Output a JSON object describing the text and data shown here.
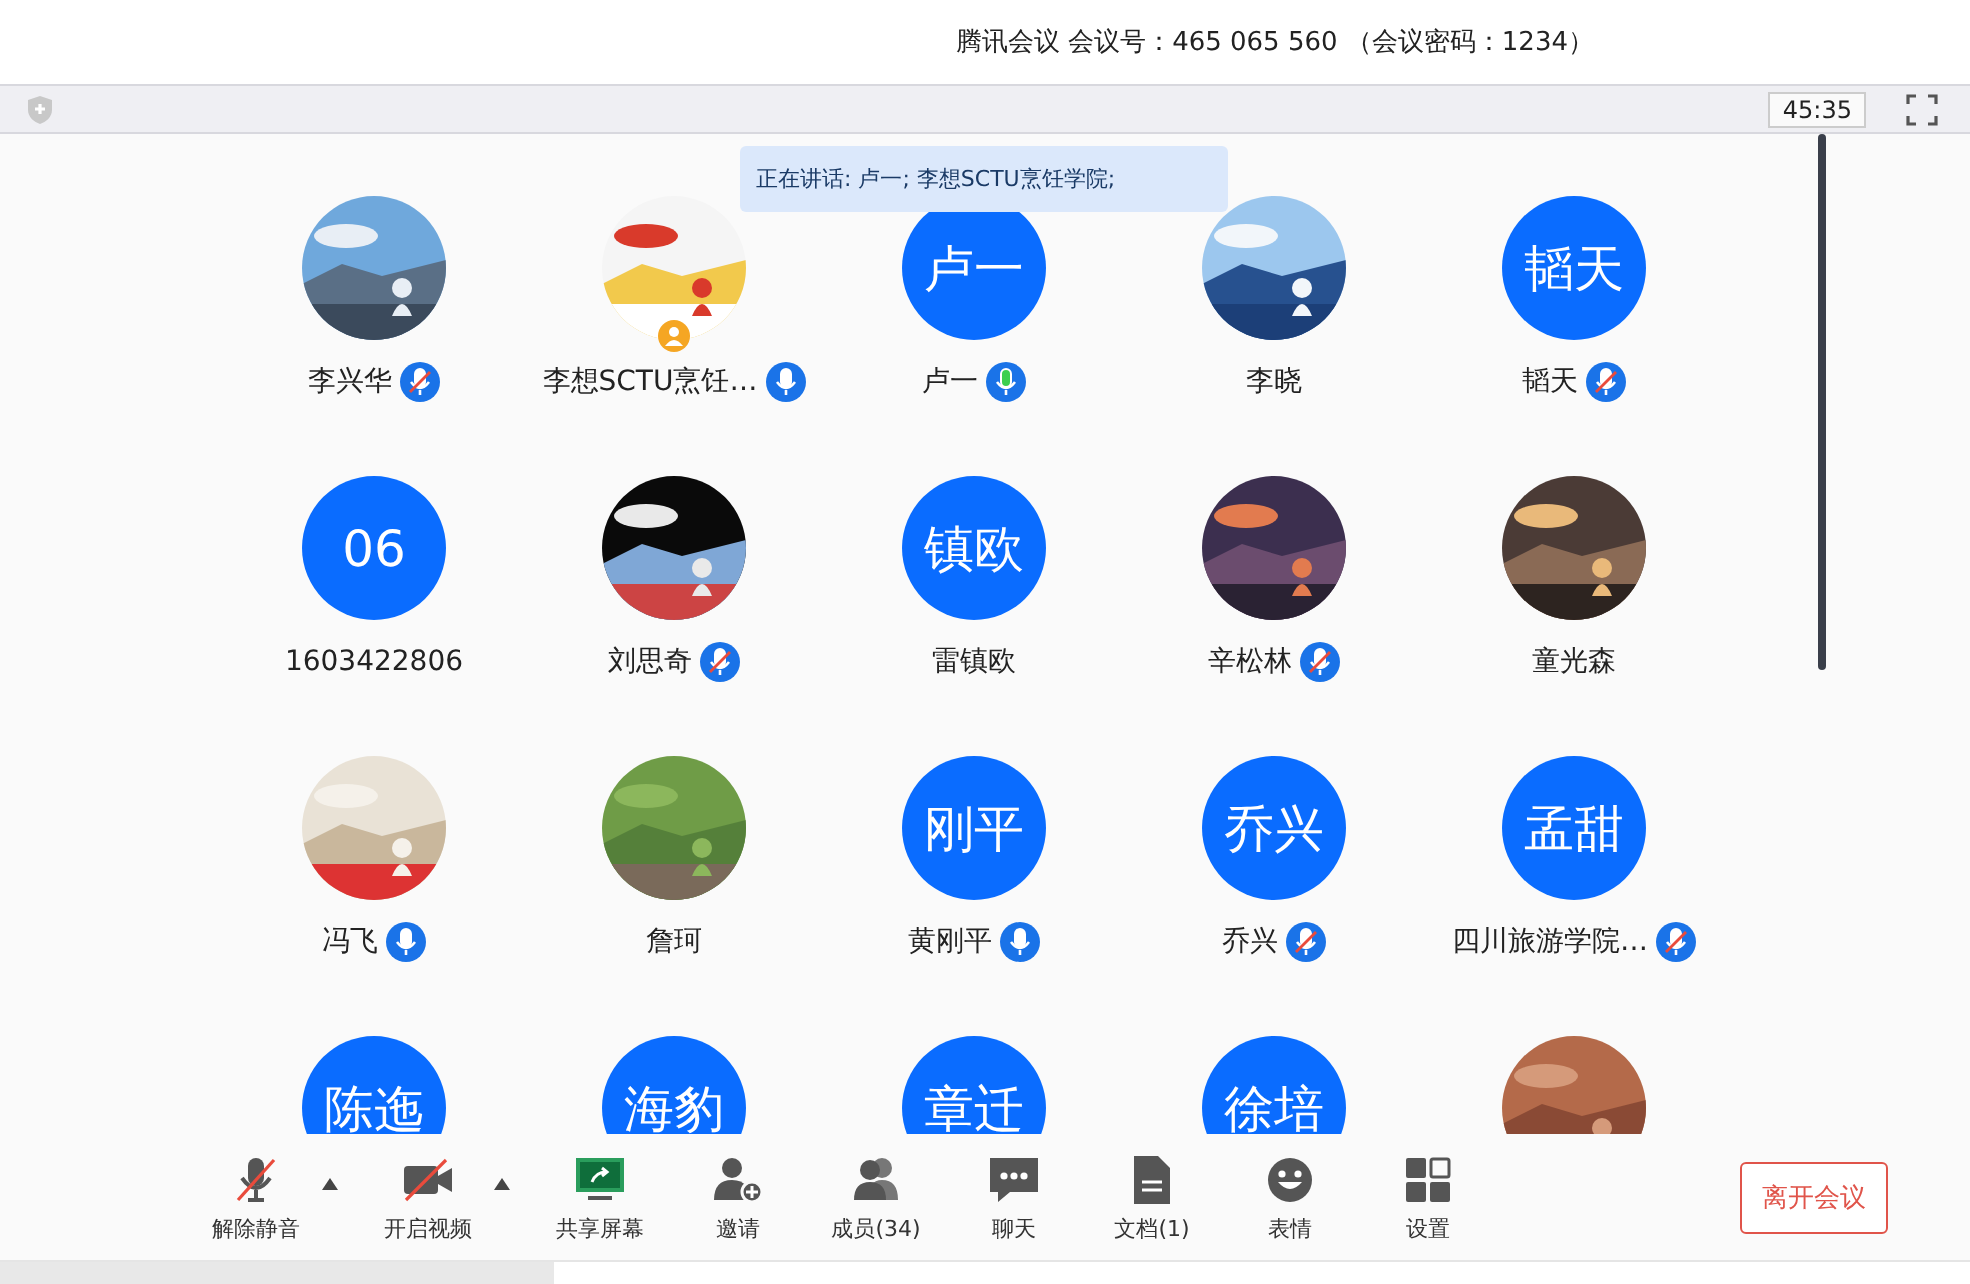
{
  "meeting_title": "腾讯会议 会议号：465 065 560 （会议密码：1234）",
  "top_bar": {
    "timer": "45:35"
  },
  "speaking_banner": "正在讲话: 卢一; 李想SCTU烹饪学院;",
  "participants": [
    {
      "name": "李兴华",
      "avatar": {
        "kind": "picture"
      },
      "muted": true,
      "speaking": false
    },
    {
      "name": "李想SCTU烹饪…",
      "avatar": {
        "kind": "picture"
      },
      "muted": false,
      "speaking": false,
      "host": true
    },
    {
      "name": "卢一",
      "avatar": {
        "kind": "initials",
        "text": "卢一"
      },
      "muted": false,
      "speaking": true
    },
    {
      "name": "李晓",
      "avatar": {
        "kind": "picture"
      }
    },
    {
      "name": "韬天",
      "avatar": {
        "kind": "initials",
        "text": "韬天"
      },
      "muted": true,
      "speaking": false
    },
    {
      "name": "1603422806",
      "avatar": {
        "kind": "initials",
        "text": "06"
      }
    },
    {
      "name": "刘思奇",
      "avatar": {
        "kind": "picture"
      },
      "muted": true,
      "speaking": false
    },
    {
      "name": "雷镇欧",
      "avatar": {
        "kind": "initials",
        "text": "镇欧"
      }
    },
    {
      "name": "辛松林",
      "avatar": {
        "kind": "picture"
      },
      "muted": true,
      "speaking": false
    },
    {
      "name": "童光森",
      "avatar": {
        "kind": "picture"
      }
    },
    {
      "name": "冯飞",
      "avatar": {
        "kind": "picture"
      },
      "muted": false,
      "speaking": false
    },
    {
      "name": "詹珂",
      "avatar": {
        "kind": "picture"
      }
    },
    {
      "name": "黄刚平",
      "avatar": {
        "kind": "initials",
        "text": "刚平"
      },
      "muted": false,
      "speaking": false
    },
    {
      "name": "乔兴",
      "avatar": {
        "kind": "initials",
        "text": "乔兴"
      },
      "muted": true,
      "speaking": false
    },
    {
      "name": "四川旅游学院…",
      "avatar": {
        "kind": "initials",
        "text": "孟甜"
      },
      "muted": true,
      "speaking": false
    },
    {
      "avatar": {
        "kind": "initials",
        "text": "陈迤"
      }
    },
    {
      "avatar": {
        "kind": "initials",
        "text": "海豹"
      }
    },
    {
      "avatar": {
        "kind": "initials",
        "text": "章迁"
      }
    },
    {
      "avatar": {
        "kind": "initials",
        "text": "徐培"
      }
    },
    {
      "avatar": {
        "kind": "picture"
      }
    }
  ],
  "toolbar": [
    {
      "kind": "mic",
      "label": "解除静音",
      "menu": true
    },
    {
      "kind": "video",
      "label": "开启视频",
      "menu": true
    },
    {
      "kind": "share",
      "label": "共享屏幕"
    },
    {
      "kind": "invite",
      "label": "邀请"
    },
    {
      "kind": "members",
      "label": "成员(34)"
    },
    {
      "kind": "chat",
      "label": "聊天"
    },
    {
      "kind": "docs",
      "label": "文档(1)"
    },
    {
      "kind": "emoji",
      "label": "表情"
    },
    {
      "kind": "settings",
      "label": "设置"
    }
  ],
  "leave_button": "离开会议"
}
